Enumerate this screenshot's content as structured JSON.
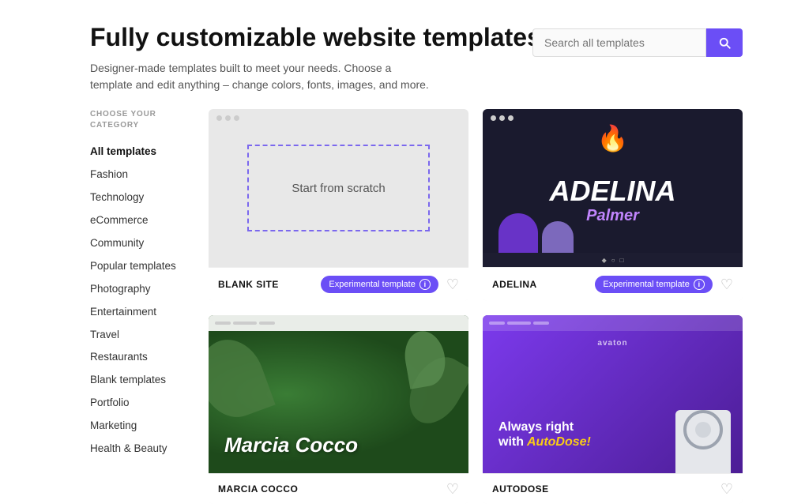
{
  "page": {
    "title": "Fully customizable website templates",
    "subtitle": "Designer-made templates built to meet your needs. Choose a template and edit anything – change colors, fonts, images, and more."
  },
  "search": {
    "placeholder": "Search all templates",
    "button_label": "Search"
  },
  "sidebar": {
    "category_label": "CHOOSE YOUR CATEGORY",
    "items": [
      {
        "id": "all-templates",
        "label": "All templates",
        "active": true
      },
      {
        "id": "fashion",
        "label": "Fashion",
        "active": false
      },
      {
        "id": "technology",
        "label": "Technology",
        "active": false
      },
      {
        "id": "ecommerce",
        "label": "eCommerce",
        "active": false
      },
      {
        "id": "community",
        "label": "Community",
        "active": false
      },
      {
        "id": "popular-templates",
        "label": "Popular templates",
        "active": false
      },
      {
        "id": "photography",
        "label": "Photography",
        "active": false
      },
      {
        "id": "entertainment",
        "label": "Entertainment",
        "active": false
      },
      {
        "id": "travel",
        "label": "Travel",
        "active": false
      },
      {
        "id": "restaurants",
        "label": "Restaurants",
        "active": false
      },
      {
        "id": "blank-templates",
        "label": "Blank templates",
        "active": false
      },
      {
        "id": "portfolio",
        "label": "Portfolio",
        "active": false
      },
      {
        "id": "marketing",
        "label": "Marketing",
        "active": false
      },
      {
        "id": "health-beauty",
        "label": "Health & Beauty",
        "active": false
      }
    ]
  },
  "templates": [
    {
      "id": "blank-site",
      "name": "BLANK SITE",
      "badge": "Experimental template",
      "type": "blank",
      "center_text": "Start from scratch"
    },
    {
      "id": "adelina",
      "name": "ADELINA",
      "badge": "Experimental template",
      "type": "adelina",
      "title_line1": "ADELINA",
      "title_line2": "Palmer"
    },
    {
      "id": "marcia-cocco",
      "name": "MARCIA COCCO",
      "badge": null,
      "type": "marcia",
      "name_text": "Marcia Cocco"
    },
    {
      "id": "autodose",
      "name": "AUTODOSE",
      "badge": null,
      "type": "autodose",
      "line1": "Always right",
      "line2": "with AutoDose!"
    }
  ],
  "colors": {
    "accent": "#6b4ef6",
    "active_text": "#111111",
    "muted_text": "#999999"
  }
}
